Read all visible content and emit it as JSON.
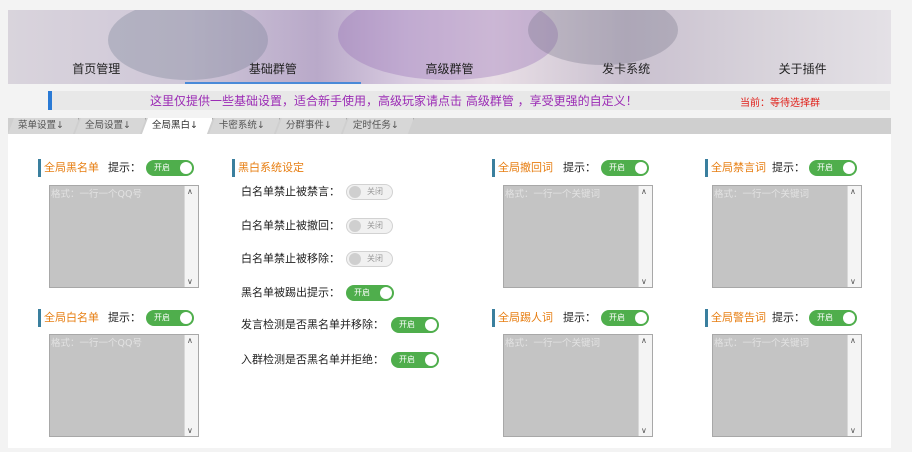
{
  "nav": [
    "首页管理",
    "基础群管",
    "高级群管",
    "发卡系统",
    "关于插件"
  ],
  "notice": {
    "message": "这里仅提供一些基础设置，适合新手使用，高级玩家请点击 高级群管 ，享受更强的自定义！",
    "current": "当前：等待选择群"
  },
  "tabs": [
    "菜单设置↓",
    "全局设置↓",
    "全局黑白↓",
    "卡密系统↓",
    "分群事件↓",
    "定时任务↓"
  ],
  "active_tab": "全局黑白↓",
  "toggle_on": "开启",
  "toggle_off": "关闭",
  "hint": "提示：",
  "lists": [
    {
      "title": "全局黑名单",
      "placeholder": "格式：一行一个QQ号"
    },
    {
      "title": "全局白名单",
      "placeholder": "格式：一行一个QQ号"
    },
    {
      "title": "全局撤回词",
      "placeholder": "格式：一行一个关键词"
    },
    {
      "title": "全局踢人词",
      "placeholder": "格式：一行一个关键词"
    },
    {
      "title": "全局禁言词",
      "placeholder": "格式：一行一个关键词"
    },
    {
      "title": "全局警告词",
      "placeholder": "格式：一行一个关键词"
    }
  ],
  "bw": {
    "title": "黑白系统设定",
    "rows": [
      {
        "label": "白名单禁止被禁言：",
        "state": "off"
      },
      {
        "label": "白名单禁止被撤回：",
        "state": "off"
      },
      {
        "label": "白名单禁止被移除：",
        "state": "off"
      },
      {
        "label": "黑名单被踢出提示：",
        "state": "on"
      },
      {
        "label": "发言检测是否黑名单并移除：",
        "state": "on"
      },
      {
        "label": "入群检测是否黑名单并拒绝：",
        "state": "on"
      }
    ]
  },
  "colors": {
    "accent_orange": "#e77e12",
    "toggle_green": "#4fae4c",
    "notice_purple": "#9b2bb5",
    "notice_red": "#e0201a"
  }
}
